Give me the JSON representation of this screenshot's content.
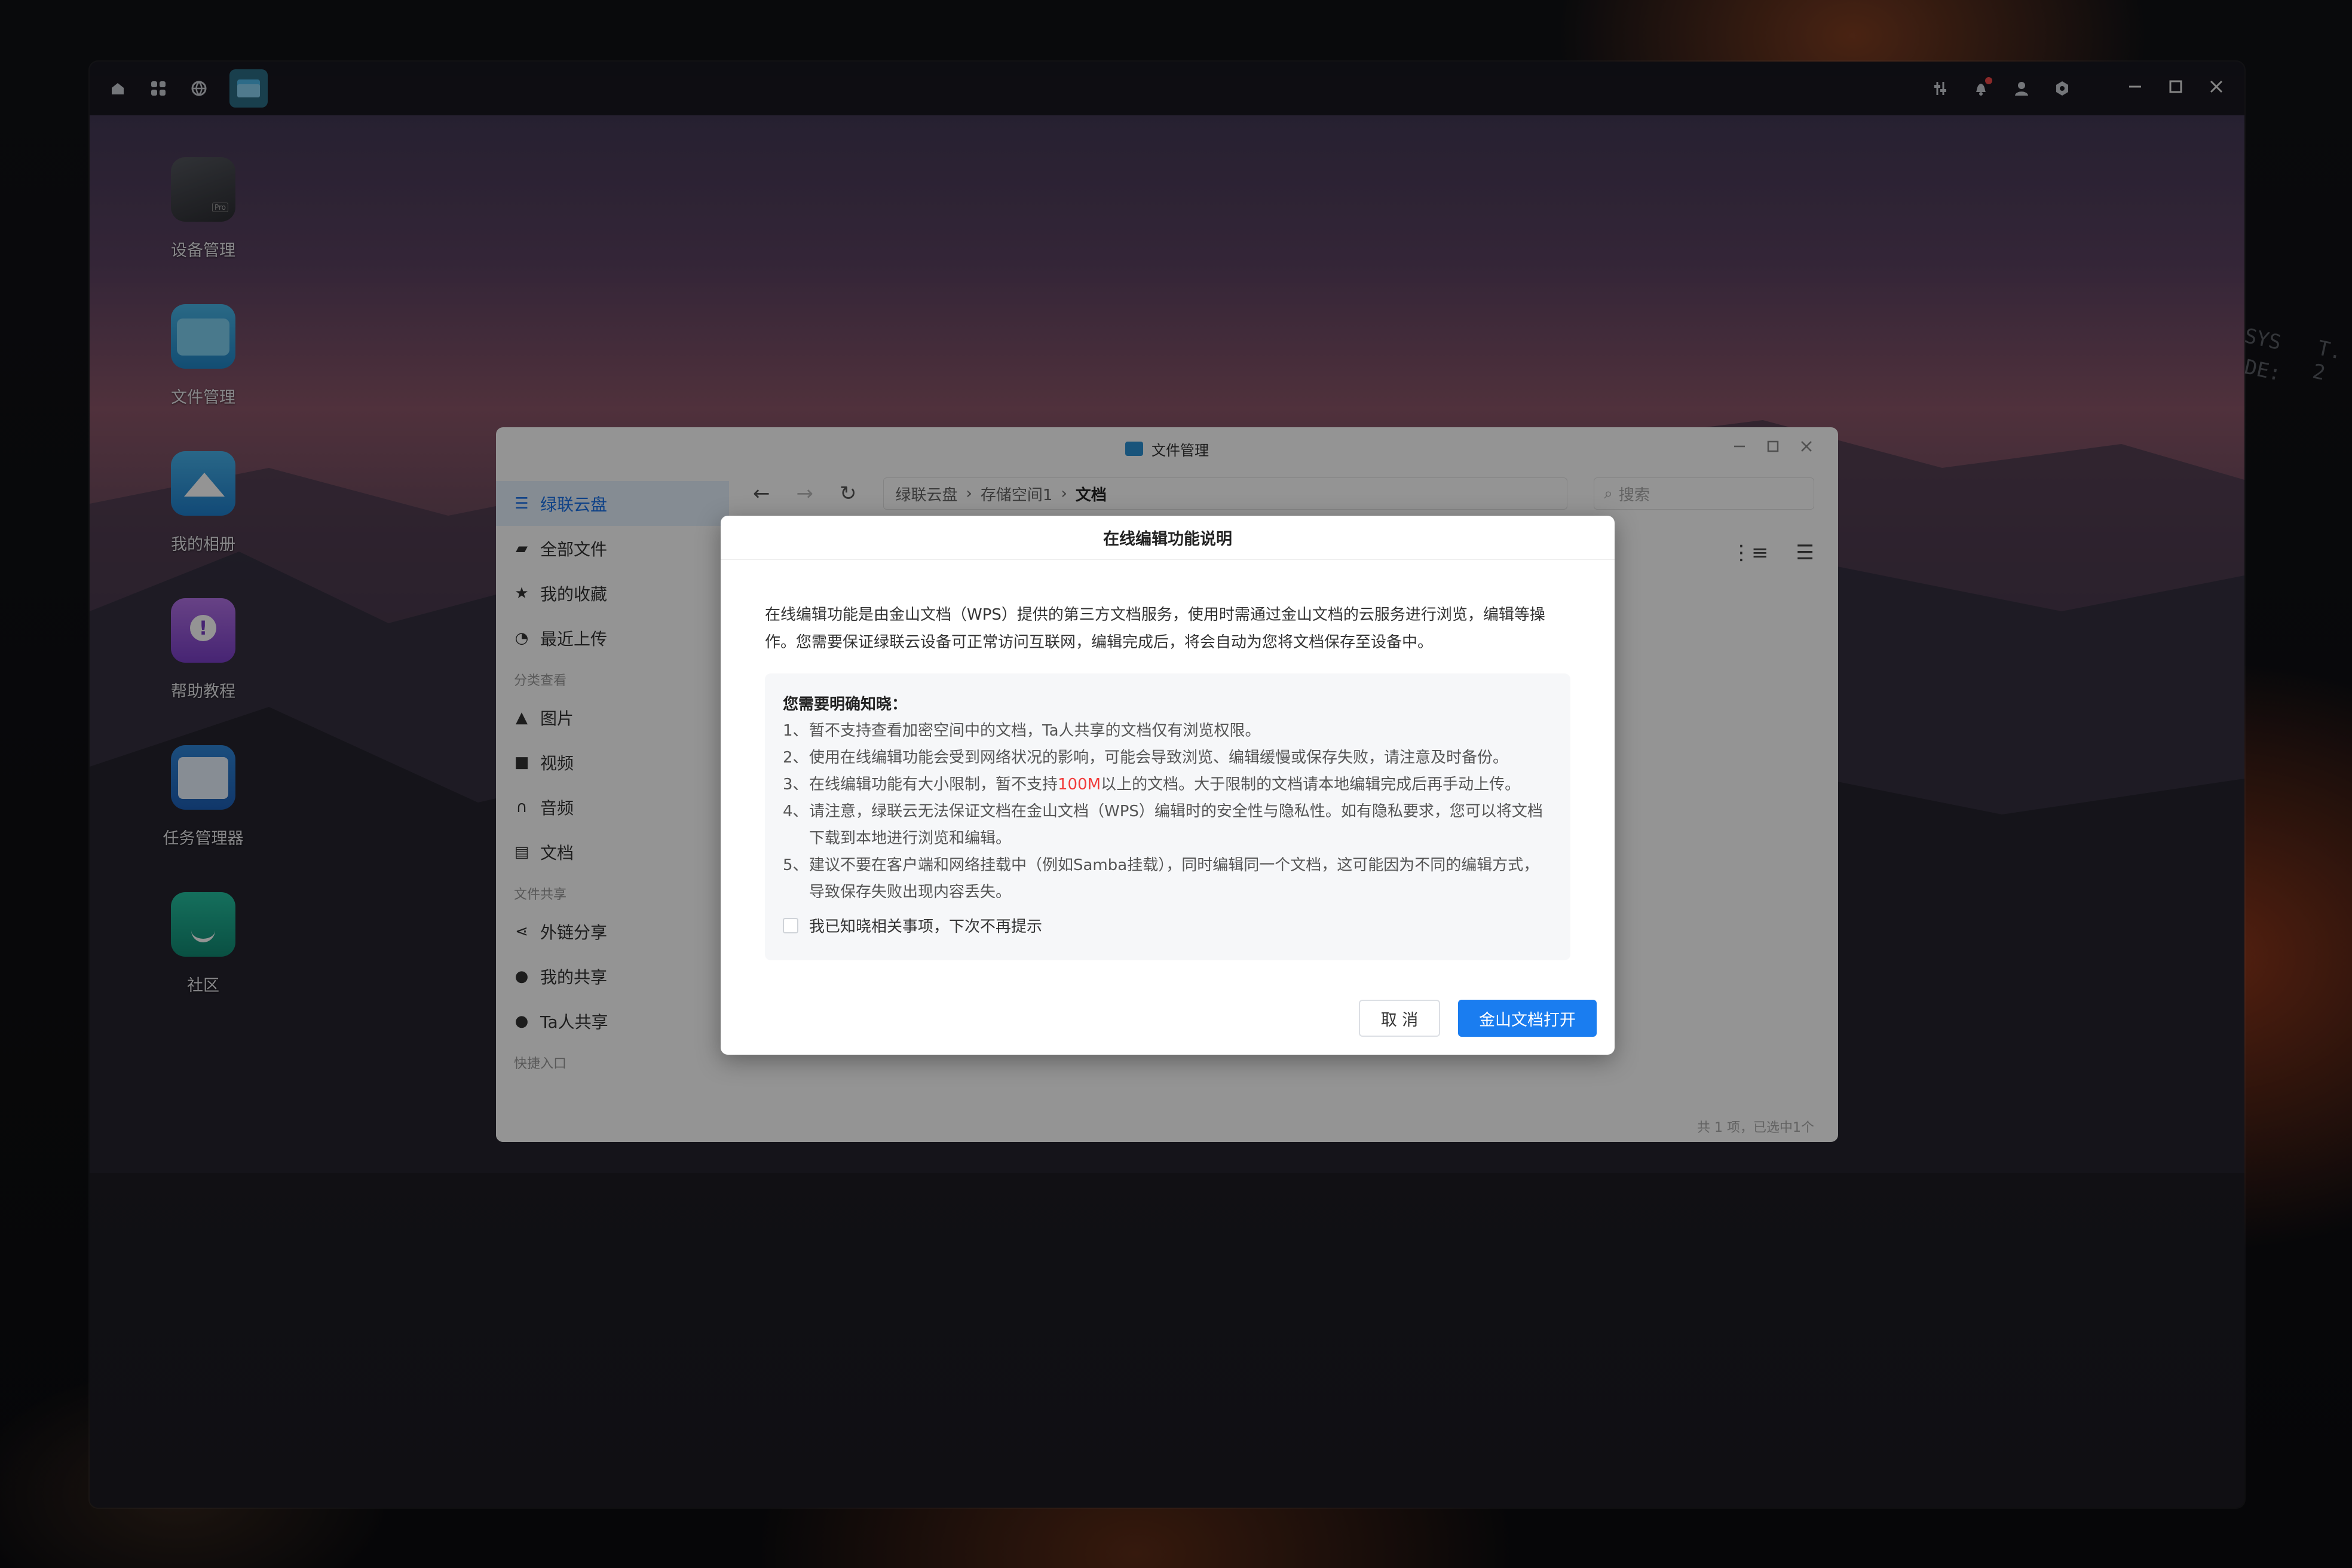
{
  "desktop": {
    "topbar": {
      "left_icons": [
        "home-icon",
        "apps-grid-icon",
        "globe-icon",
        "file-manager-app-icon"
      ],
      "right_icons": [
        "equalizer-icon",
        "bell-icon",
        "user-icon",
        "settings-icon"
      ]
    },
    "icons": [
      {
        "label": "设备管理",
        "icon": "device-manager-icon"
      },
      {
        "label": "文件管理",
        "icon": "file-manager-icon"
      },
      {
        "label": "我的相册",
        "icon": "photo-album-icon"
      },
      {
        "label": "帮助教程",
        "icon": "help-icon"
      },
      {
        "label": "任务管理器",
        "icon": "task-manager-icon"
      },
      {
        "label": "社区",
        "icon": "community-icon"
      }
    ],
    "deco_text": {
      "sys": "SYS",
      "t2": "T. 2",
      "de": "DE:"
    }
  },
  "file_manager": {
    "title": "文件管理",
    "sidebar": {
      "items_top": [
        {
          "label": "绿联云盘",
          "icon": "cloud-drive-icon",
          "active": true
        },
        {
          "label": "全部文件",
          "icon": "folder-icon"
        },
        {
          "label": "我的收藏",
          "icon": "star-icon"
        },
        {
          "label": "最近上传",
          "icon": "clock-icon"
        }
      ],
      "section_categories": "分类查看",
      "items_categories": [
        {
          "label": "图片",
          "icon": "image-icon"
        },
        {
          "label": "视频",
          "icon": "video-icon"
        },
        {
          "label": "音频",
          "icon": "headphones-icon"
        },
        {
          "label": "文档",
          "icon": "document-icon"
        }
      ],
      "section_share": "文件共享",
      "items_share": [
        {
          "label": "外链分享",
          "icon": "share-icon"
        },
        {
          "label": "我的共享",
          "icon": "users-icon"
        },
        {
          "label": "Ta人共享",
          "icon": "users-icon"
        }
      ],
      "section_quick": "快捷入口"
    },
    "breadcrumb": [
      "绿联云盘",
      "存储空间1",
      "文档"
    ],
    "search_placeholder": "搜索",
    "status": "共 1 项，已选中1个"
  },
  "dialog": {
    "title": "在线编辑功能说明",
    "intro": "在线编辑功能是由金山文档（WPS）提供的第三方文档服务，使用时需通过金山文档的云服务进行浏览，编辑等操作。您需要保证绿联云设备可正常访问互联网，编辑完成后，将会自动为您将文档保存至设备中。",
    "notice_head": "您需要明确知晓：",
    "notices": [
      {
        "num": "1、",
        "text": "暂不支持查看加密空间中的文档，Ta人共享的文档仅有浏览权限。"
      },
      {
        "num": "2、",
        "text": "使用在线编辑功能会受到网络状况的影响，可能会导致浏览、编辑缓慢或保存失败，请注意及时备份。"
      },
      {
        "num": "3、",
        "text_before": "在线编辑功能有大小限制，暂不支持",
        "text_red": "100M",
        "text_after": "以上的文档。大于限制的文档请本地编辑完成后再手动上传。"
      },
      {
        "num": "4、",
        "text": "请注意，绿联云无法保证文档在金山文档（WPS）编辑时的安全性与隐私性。如有隐私要求，您可以将文档下载到本地进行浏览和编辑。"
      },
      {
        "num": "5、",
        "text": "建议不要在客户端和网络挂载中（例如Samba挂载），同时编辑同一个文档，这可能因为不同的编辑方式，导致保存失败出现内容丢失。"
      }
    ],
    "checkbox_label": "我已知晓相关事项，下次不再提示",
    "cancel_label": "取 消",
    "confirm_label": "金山文档打开",
    "colors": {
      "primary": "#1a7df0",
      "warning": "#f13a3a"
    }
  }
}
